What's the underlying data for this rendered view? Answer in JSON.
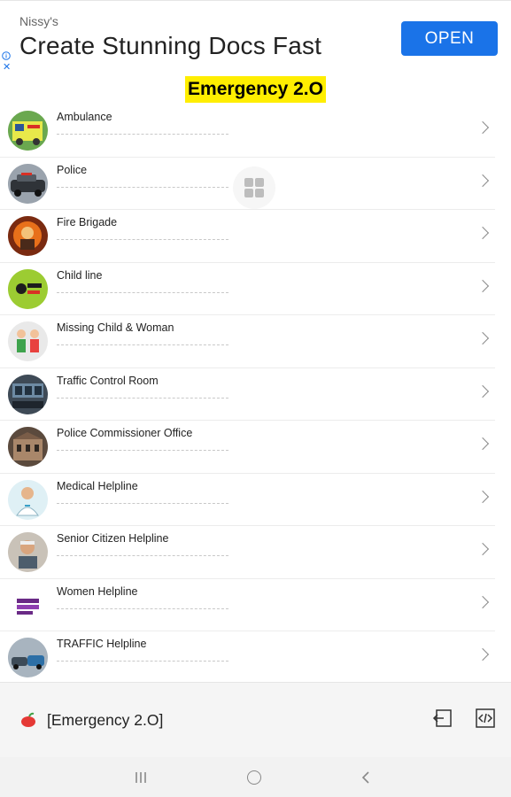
{
  "ad": {
    "advertiser": "Nissy's",
    "headline": "Create Stunning Docs Fast",
    "button_label": "OPEN",
    "close_glyph": "✕"
  },
  "app_title": "Emergency 2.O",
  "services": [
    {
      "name": "Ambulance",
      "icon": "ambulance-icon"
    },
    {
      "name": "Police",
      "icon": "police-car-icon"
    },
    {
      "name": "Fire Brigade",
      "icon": "firefighter-icon"
    },
    {
      "name": "Child line",
      "icon": "childline-logo-icon"
    },
    {
      "name": "Missing Child & Woman",
      "icon": "children-icon"
    },
    {
      "name": "Traffic Control Room",
      "icon": "traffic-control-icon"
    },
    {
      "name": "Police Commissioner Office",
      "icon": "building-icon"
    },
    {
      "name": "Medical Helpline",
      "icon": "doctor-icon"
    },
    {
      "name": "Senior Citizen Helpline",
      "icon": "senior-icon"
    },
    {
      "name": "Women Helpline",
      "icon": "women-helpline-icon"
    },
    {
      "name": "TRAFFIC Helpline",
      "icon": "traffic-icon"
    }
  ],
  "bottom_bar": {
    "title": "[Emergency 2.O]",
    "app_icon": "chili-icon",
    "exit_icon": "exit-icon",
    "source_icon": "code-icon"
  },
  "colors": {
    "accent": "#1a73e8",
    "title_highlight": "#ffee00"
  }
}
